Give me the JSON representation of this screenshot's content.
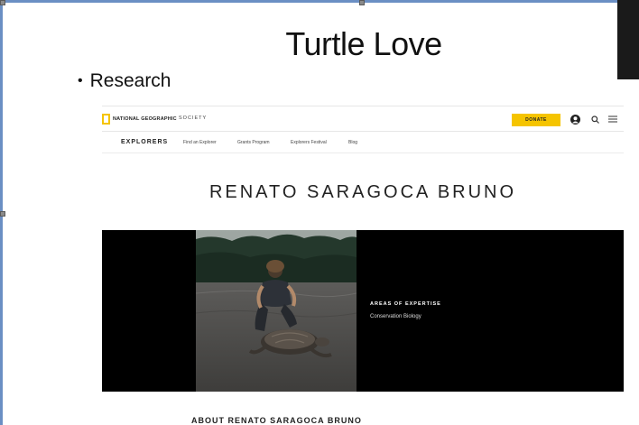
{
  "slide": {
    "title": "Turtle Love",
    "bullets": [
      {
        "text": "Research"
      }
    ]
  },
  "web": {
    "logo_text": "NATIONAL GEOGRAPHIC",
    "society": "SOCIETY",
    "donate_label": "DONATE",
    "icons": [
      "user-icon",
      "search-icon",
      "menu-icon"
    ],
    "subnav": {
      "brand": "EXPLORERS",
      "links": [
        "Find an Explorer",
        "Grants Program",
        "Explorers Festival",
        "Blog"
      ]
    },
    "explorer_name": "RENATO SARAGOCA BRUNO",
    "expertise_label": "AREAS OF EXPERTISE",
    "expertise_value": "Conservation Biology",
    "about_heading": "ABOUT RENATO SARAGOCA BRUNO"
  },
  "colors": {
    "donate": "#f5c400",
    "hero_bg": "#000000",
    "frame": "#6b8fc4"
  }
}
